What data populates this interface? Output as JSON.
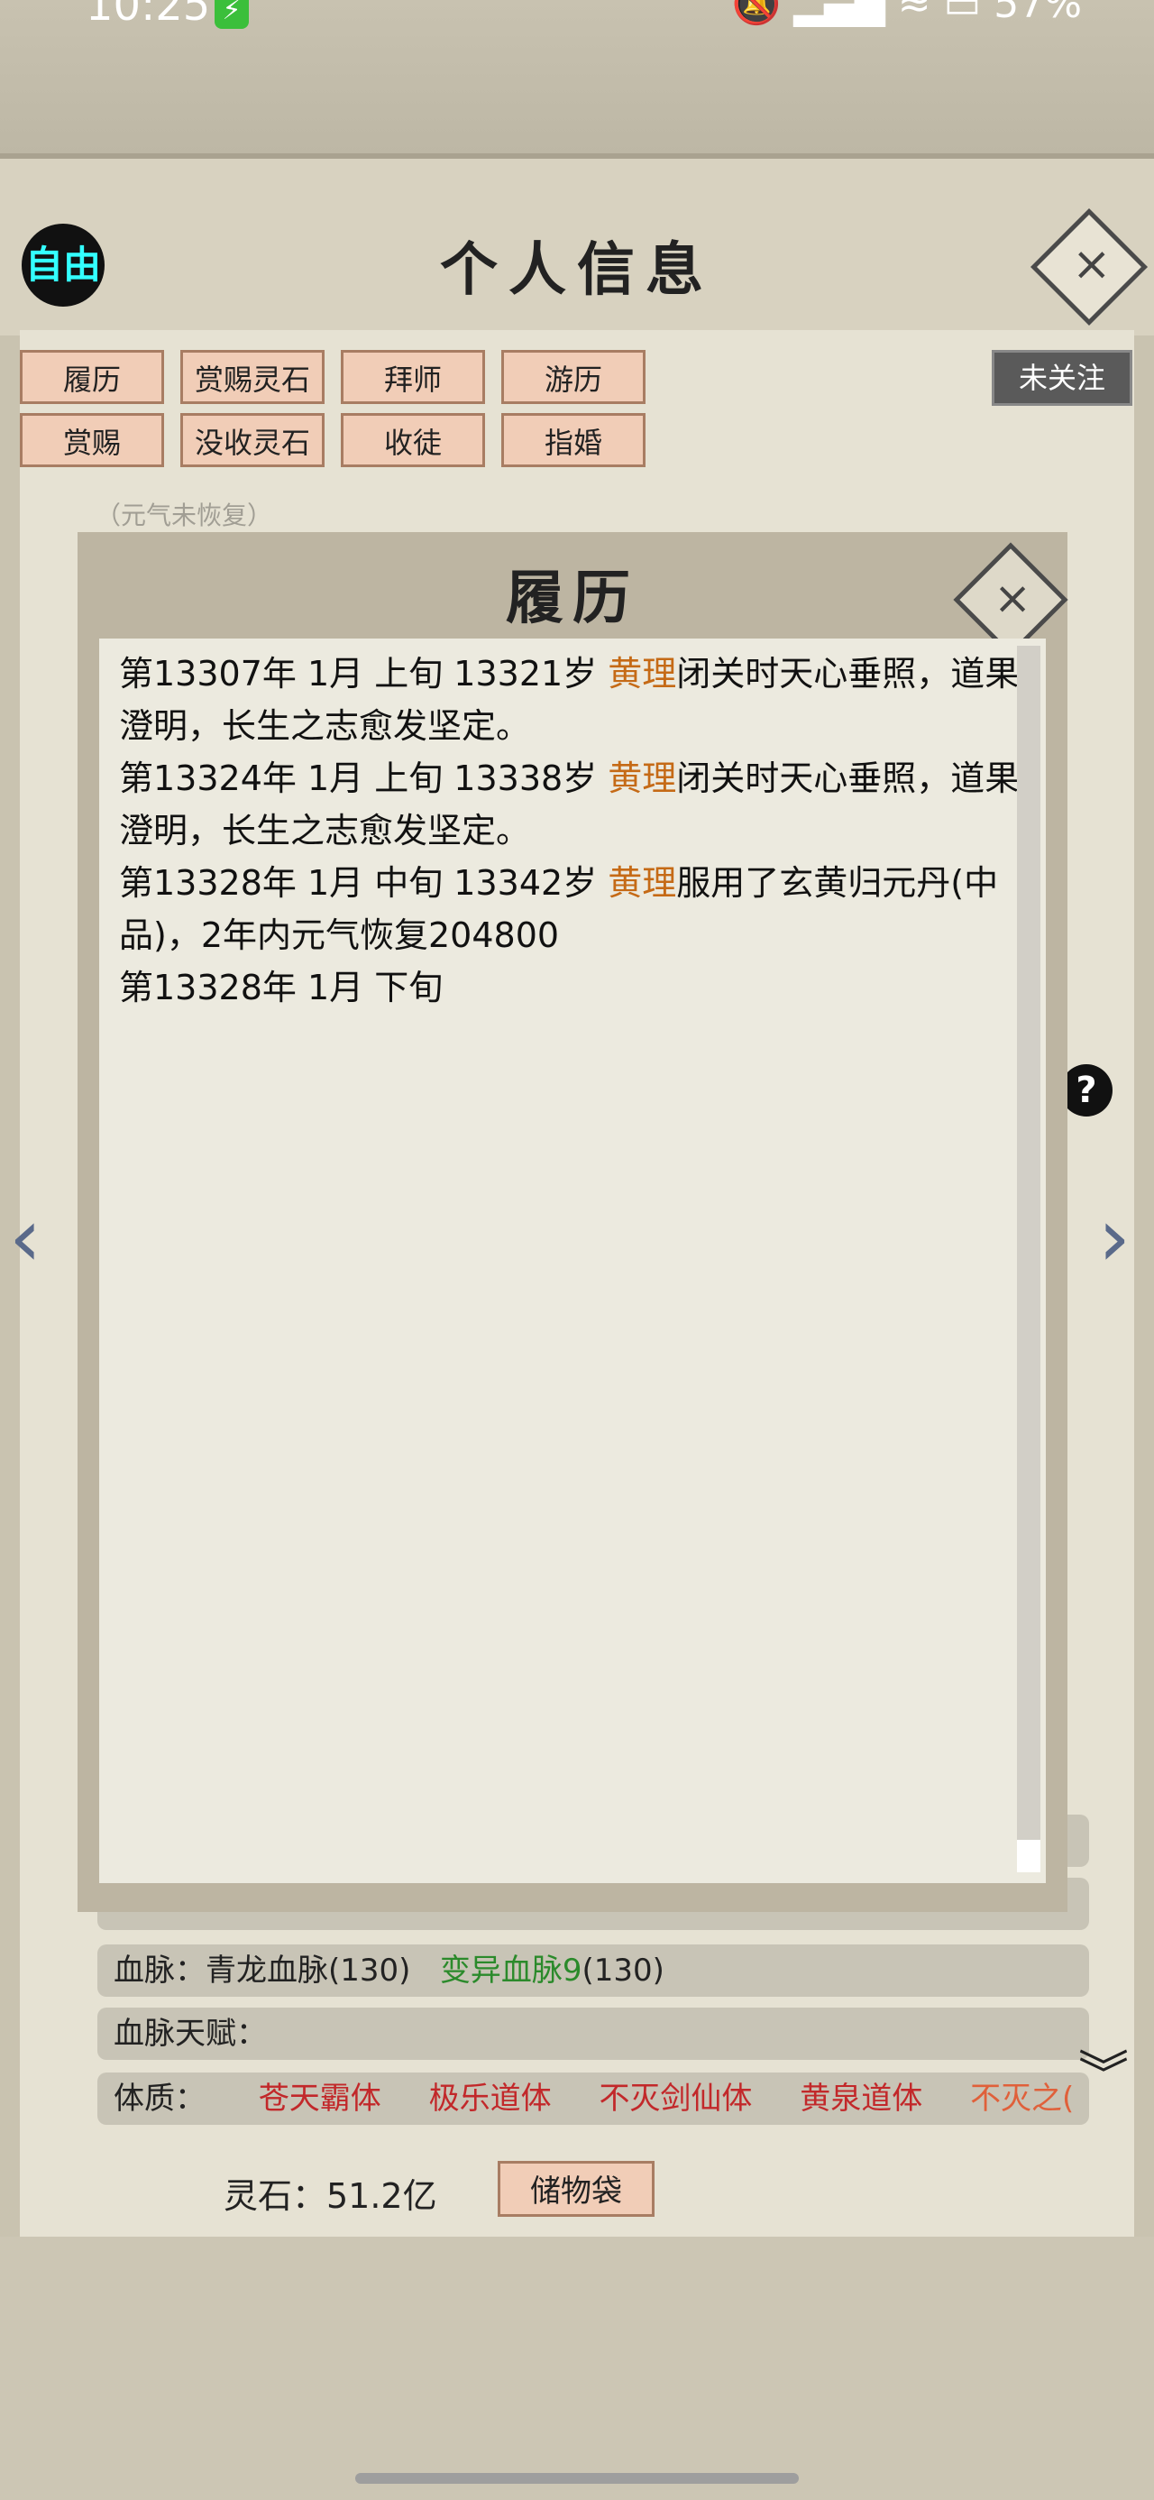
{
  "status": {
    "time": "10:25",
    "battery": "57%"
  },
  "header": {
    "free_badge": "自由",
    "title": "个人信息",
    "close": "×"
  },
  "tabs": {
    "row1": [
      "履历",
      "赏赐灵石",
      "拜师",
      "游历"
    ],
    "row2": [
      "赏赐",
      "没收灵石",
      "收徒",
      "指婚"
    ]
  },
  "follow_label": "未关注",
  "background": {
    "qi_note": "（元气未恢复）"
  },
  "modal": {
    "title": "履历",
    "close": "×",
    "entries": [
      {
        "pre": "第13307年 1月 上旬 13321岁 ",
        "name": "黄理",
        "post": "闭关时天心垂照，道果澄明，长生之志愈发坚定。"
      },
      {
        "pre": "第13324年 1月 上旬 13338岁 ",
        "name": "黄理",
        "post": "闭关时天心垂照，道果澄明，长生之志愈发坚定。"
      },
      {
        "pre": "第13328年 1月 中旬 13342岁 ",
        "name": "黄理",
        "post": "服用了玄黄归元丹(中品)，2年内元气恢复204800"
      },
      {
        "pre": "第13328年 1月 下旬",
        "name": "",
        "post": ""
      }
    ]
  },
  "info": {
    "bloodline_label": "血脉：",
    "bloodline_value": "青龙血脉(130)",
    "mutation_value": "变异血脉9",
    "mutation_suffix": "(130)",
    "bloodline_talent_label": "血脉天赋：",
    "constitution_label": "体质：",
    "constitutions": [
      "苍天霸体",
      "极乐道体",
      "不灭剑仙体",
      "黄泉道体",
      "不灭之("
    ]
  },
  "footer": {
    "spirit_stones": "灵石：51.2亿",
    "bag_button": "储物袋"
  }
}
